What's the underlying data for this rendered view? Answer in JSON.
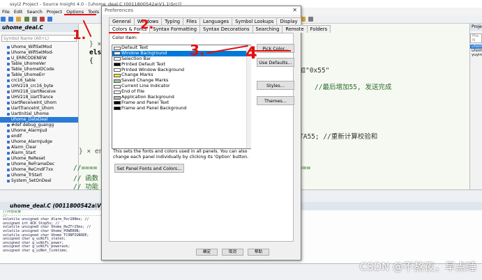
{
  "app": {
    "title": "ssyi2 Project - Source Insight 4.0 - [uhome_deal.C (0011800542a\\V1.1\\Src)]"
  },
  "menu": [
    "File",
    "Edit",
    "Search",
    "Project",
    "Options",
    "Tools"
  ],
  "left_panel": {
    "title": "uhome_deal.C",
    "search_placeholder": "Symbol Name (Alt+L)",
    "symbols": [
      "Uhome_WifiSetMod",
      "Uhome_WifiSetMod-",
      "U_ERRCODENEW",
      "Table_UhomeVer",
      "Table_UhomeIDCode",
      "Table_UhomeErr",
      "crc16_table",
      "UHV219_crc16_byte",
      "UHV218_UartReceive",
      "UHV218_UartTrance",
      "UartReceiveInt_Uhom",
      "UartTranceInt_Uhom",
      "UartInitial_Uhome",
      "Uhome_DataDeal",
      "#def debug_guangg",
      "Uhome_AlarmJud",
      "endif",
      "Uhome_AlarmJudge",
      "Alarm_Clear",
      "Alarm_Start",
      "Uhome_ReReset",
      "Uhome_ReFrameDec",
      "Uhome_ReCmdF7xx",
      "Uhome_TrStart",
      "System_SetOnDeal"
    ]
  },
  "code": {
    "l1": "} ×",
    "l2": "els",
    "l3": "{",
    "l4": "增加\"0x55\"",
    "l5": "//最后增加55, 发送完成",
    "l6": "TA55; //重新计算校验和",
    "l7": "} × end",
    "l8": "//====",
    "l9": "// 函数",
    "l10": "// 功能",
    "l11": "==="
  },
  "right_panel": {
    "title": "Proje",
    "placeholder": "File N",
    "items": [
      "uhom",
      "uhom",
      "yuyin"
    ]
  },
  "bottom": {
    "title": "uhome_deal.C (0011800542a\\V1.1\\Src)",
    "lines": [
      "//外部变量",
      "//----------------------------------------------------------",
      "volatile unsigned char Alarm_Per200ms;   //",
      "unsigned int ACK_Stop5s;                 //",
      "volatile unsigned char Uhome_ReZTr25ms;  //",
      "volatile unsigned char Uhome_POWERON;",
      "volatile unsigned char Uhome_TCONFIGNODE;",
      "unsigned char g_ucWiFi_states;",
      "unsigned char g_ucWiFi_power;",
      "unsigned char g_ucWiFi_powerask;",
      "unsigned char g_ucNet_linktime;"
    ]
  },
  "watermark": "CSDN @不熬夜，早点睡",
  "dialog": {
    "title": "Preferences",
    "tabs_row1": [
      "General",
      "Windows",
      "Typing",
      "Files",
      "Languages",
      "Symbol Lookups",
      "Display"
    ],
    "tabs_row2": [
      "Colors & Fonts",
      "Syntax Formatting",
      "Syntax Decorations",
      "Searching",
      "Remote",
      "Folders"
    ],
    "color_item_label": "Color Item:",
    "color_items": [
      {
        "label": "Default Text",
        "color": "#ffffff"
      },
      {
        "label": "Window Background",
        "color": "#ffffff"
      },
      {
        "label": "Selection Bar",
        "color": "#ffffff"
      },
      {
        "label": "Printed Default Text",
        "color": "#000000"
      },
      {
        "label": "Printed Window Background",
        "color": "#ffffff"
      },
      {
        "label": "Change Marks",
        "color": "#f0e040"
      },
      {
        "label": "Saved Change Marks",
        "color": "#9ec79e"
      },
      {
        "label": "Current Line Indicator",
        "color": "#ffffff"
      },
      {
        "label": "End of File",
        "color": "#ffffff"
      },
      {
        "label": "Application Background",
        "color": "#b8b8b8"
      },
      {
        "label": "Frame and Panel Text",
        "color": "#000000"
      },
      {
        "label": "Frame and Panel Background",
        "color": "#000000"
      }
    ],
    "buttons": {
      "pick_color": "Pick Color...",
      "use_defaults": "Use Defaults...",
      "styles": "Styles...",
      "themes": "Themes...",
      "panel_fonts": "Set Panel Fonts and Colors..."
    },
    "description": "This sets the fonts and colors used in all panels. You can also change each panel individually by clicking its 'Option' button.",
    "footer": {
      "ok": "确定",
      "cancel": "取消",
      "help": "帮助"
    }
  },
  "annotations": {
    "n1": "1.",
    "n2": "2.",
    "n3": "3.",
    "n4": "4"
  },
  "colors": {
    "accent": "#0078d7",
    "annotation": "#e01010",
    "code_bg": "#f6f9f2"
  }
}
